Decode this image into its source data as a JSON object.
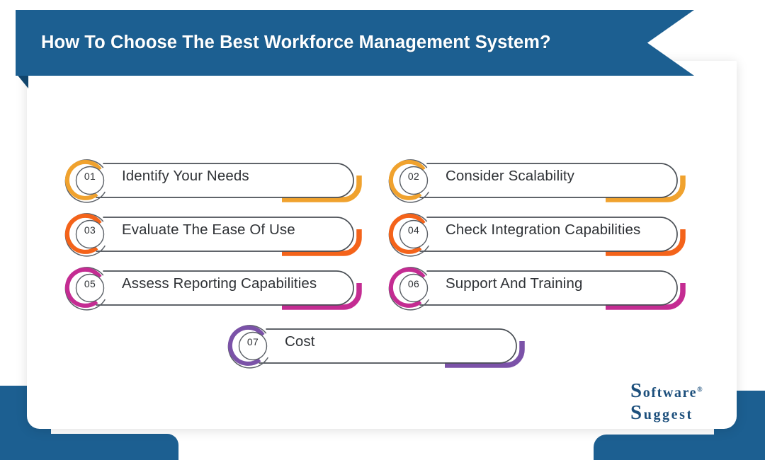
{
  "header": {
    "title": "How To Choose The Best Workforce Management System?",
    "background_color": "#1c5f91",
    "fold_color": "#11456c",
    "text_color": "#ffffff"
  },
  "palette": {
    "orange": "#f0a22e",
    "deep_orange": "#f4631a",
    "magenta": "#c42c92",
    "purple": "#7b52a8",
    "outline_gray": "#4a4f55",
    "ring_gray": "#5a5f66",
    "text_dark": "#2f3236",
    "brand_blue": "#1c5f91",
    "card_white": "#ffffff"
  },
  "steps": [
    {
      "number": "01",
      "label": "Identify Your Needs",
      "color": "#f0a22e"
    },
    {
      "number": "02",
      "label": "Consider Scalability",
      "color": "#f0a22e"
    },
    {
      "number": "03",
      "label": "Evaluate The Ease Of Use",
      "color": "#f4631a"
    },
    {
      "number": "04",
      "label": "Check Integration Capabilities",
      "color": "#f4631a"
    },
    {
      "number": "05",
      "label": "Assess Reporting Capabilities",
      "color": "#c42c92"
    },
    {
      "number": "06",
      "label": "Support And Training",
      "color": "#c42c92"
    },
    {
      "number": "07",
      "label": "Cost",
      "color": "#7b52a8"
    }
  ],
  "logo": {
    "line1": "oftware",
    "line1_cap": "S",
    "line2": "uggest",
    "line2_cap": "S",
    "registered": "®",
    "color": "#1c4f7c"
  }
}
